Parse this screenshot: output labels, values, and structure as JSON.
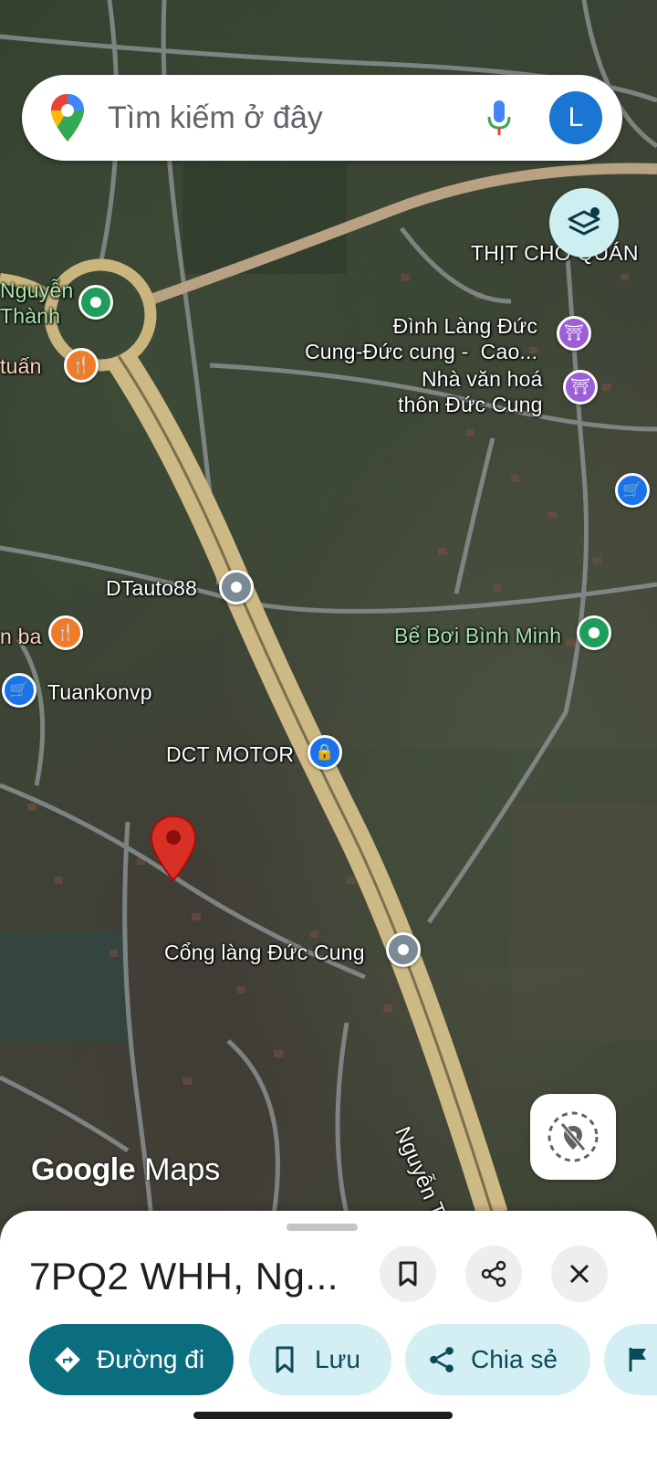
{
  "search": {
    "placeholder": "Tìm kiếm ở đây",
    "avatar_letter": "L"
  },
  "map_labels": {
    "nguyen_thanh": "Nguyễn\nThành",
    "tuan": "tuấn",
    "thit_cho_quan": "THỊT CHÓ QUÁN",
    "dinh_lang": "Đình Làng Đức\nCung-Đức cung -  Cao...",
    "nha_van_hoa": "Nhà văn hoá\nthôn Đức Cung",
    "dtauto": "DTauto88",
    "be_boi": "Bể Bơi Bình Minh",
    "ba": "n ba",
    "tuankonvp": "Tuankonvp",
    "dct_motor": "DCT MOTOR",
    "cong_lang": "Cổng làng Đức Cung",
    "road": "Nguyễn Tất T"
  },
  "watermark": {
    "google": "Google",
    "maps": "Maps"
  },
  "sheet": {
    "title": "7PQ2 WHH, Ng...",
    "actions": {
      "directions": "Đường đi",
      "save": "Lưu",
      "share": "Chia sẻ"
    }
  },
  "colors": {
    "primary_chip": "#0b6e7f",
    "secondary_chip": "#d3eff4",
    "avatar": "#1976d2",
    "pin_red": "#d93025"
  },
  "icons": [
    "google-maps-logo-icon",
    "mic-icon",
    "layers-icon",
    "location-off-icon",
    "bookmark-icon",
    "share-icon",
    "close-icon",
    "directions-icon",
    "flag-icon"
  ]
}
